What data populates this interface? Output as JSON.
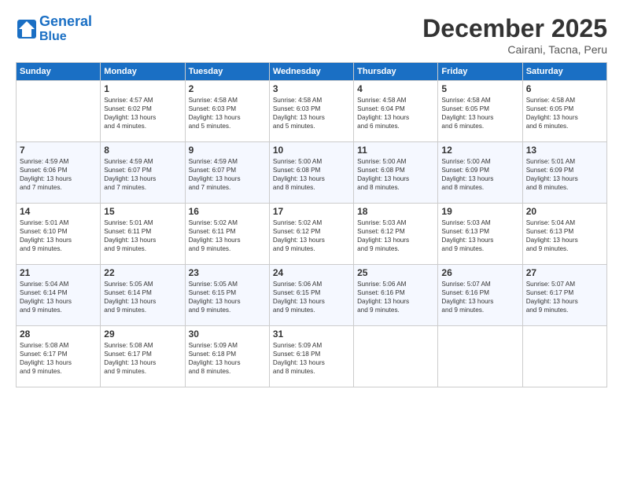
{
  "header": {
    "logo_line1": "General",
    "logo_line2": "Blue",
    "month": "December 2025",
    "location": "Cairani, Tacna, Peru"
  },
  "weekdays": [
    "Sunday",
    "Monday",
    "Tuesday",
    "Wednesday",
    "Thursday",
    "Friday",
    "Saturday"
  ],
  "weeks": [
    [
      {
        "day": "",
        "info": ""
      },
      {
        "day": "1",
        "info": "Sunrise: 4:57 AM\nSunset: 6:02 PM\nDaylight: 13 hours\nand 4 minutes."
      },
      {
        "day": "2",
        "info": "Sunrise: 4:58 AM\nSunset: 6:03 PM\nDaylight: 13 hours\nand 5 minutes."
      },
      {
        "day": "3",
        "info": "Sunrise: 4:58 AM\nSunset: 6:03 PM\nDaylight: 13 hours\nand 5 minutes."
      },
      {
        "day": "4",
        "info": "Sunrise: 4:58 AM\nSunset: 6:04 PM\nDaylight: 13 hours\nand 6 minutes."
      },
      {
        "day": "5",
        "info": "Sunrise: 4:58 AM\nSunset: 6:05 PM\nDaylight: 13 hours\nand 6 minutes."
      },
      {
        "day": "6",
        "info": "Sunrise: 4:58 AM\nSunset: 6:05 PM\nDaylight: 13 hours\nand 6 minutes."
      }
    ],
    [
      {
        "day": "7",
        "info": "Sunrise: 4:59 AM\nSunset: 6:06 PM\nDaylight: 13 hours\nand 7 minutes."
      },
      {
        "day": "8",
        "info": "Sunrise: 4:59 AM\nSunset: 6:07 PM\nDaylight: 13 hours\nand 7 minutes."
      },
      {
        "day": "9",
        "info": "Sunrise: 4:59 AM\nSunset: 6:07 PM\nDaylight: 13 hours\nand 7 minutes."
      },
      {
        "day": "10",
        "info": "Sunrise: 5:00 AM\nSunset: 6:08 PM\nDaylight: 13 hours\nand 8 minutes."
      },
      {
        "day": "11",
        "info": "Sunrise: 5:00 AM\nSunset: 6:08 PM\nDaylight: 13 hours\nand 8 minutes."
      },
      {
        "day": "12",
        "info": "Sunrise: 5:00 AM\nSunset: 6:09 PM\nDaylight: 13 hours\nand 8 minutes."
      },
      {
        "day": "13",
        "info": "Sunrise: 5:01 AM\nSunset: 6:09 PM\nDaylight: 13 hours\nand 8 minutes."
      }
    ],
    [
      {
        "day": "14",
        "info": "Sunrise: 5:01 AM\nSunset: 6:10 PM\nDaylight: 13 hours\nand 9 minutes."
      },
      {
        "day": "15",
        "info": "Sunrise: 5:01 AM\nSunset: 6:11 PM\nDaylight: 13 hours\nand 9 minutes."
      },
      {
        "day": "16",
        "info": "Sunrise: 5:02 AM\nSunset: 6:11 PM\nDaylight: 13 hours\nand 9 minutes."
      },
      {
        "day": "17",
        "info": "Sunrise: 5:02 AM\nSunset: 6:12 PM\nDaylight: 13 hours\nand 9 minutes."
      },
      {
        "day": "18",
        "info": "Sunrise: 5:03 AM\nSunset: 6:12 PM\nDaylight: 13 hours\nand 9 minutes."
      },
      {
        "day": "19",
        "info": "Sunrise: 5:03 AM\nSunset: 6:13 PM\nDaylight: 13 hours\nand 9 minutes."
      },
      {
        "day": "20",
        "info": "Sunrise: 5:04 AM\nSunset: 6:13 PM\nDaylight: 13 hours\nand 9 minutes."
      }
    ],
    [
      {
        "day": "21",
        "info": "Sunrise: 5:04 AM\nSunset: 6:14 PM\nDaylight: 13 hours\nand 9 minutes."
      },
      {
        "day": "22",
        "info": "Sunrise: 5:05 AM\nSunset: 6:14 PM\nDaylight: 13 hours\nand 9 minutes."
      },
      {
        "day": "23",
        "info": "Sunrise: 5:05 AM\nSunset: 6:15 PM\nDaylight: 13 hours\nand 9 minutes."
      },
      {
        "day": "24",
        "info": "Sunrise: 5:06 AM\nSunset: 6:15 PM\nDaylight: 13 hours\nand 9 minutes."
      },
      {
        "day": "25",
        "info": "Sunrise: 5:06 AM\nSunset: 6:16 PM\nDaylight: 13 hours\nand 9 minutes."
      },
      {
        "day": "26",
        "info": "Sunrise: 5:07 AM\nSunset: 6:16 PM\nDaylight: 13 hours\nand 9 minutes."
      },
      {
        "day": "27",
        "info": "Sunrise: 5:07 AM\nSunset: 6:17 PM\nDaylight: 13 hours\nand 9 minutes."
      }
    ],
    [
      {
        "day": "28",
        "info": "Sunrise: 5:08 AM\nSunset: 6:17 PM\nDaylight: 13 hours\nand 9 minutes."
      },
      {
        "day": "29",
        "info": "Sunrise: 5:08 AM\nSunset: 6:17 PM\nDaylight: 13 hours\nand 9 minutes."
      },
      {
        "day": "30",
        "info": "Sunrise: 5:09 AM\nSunset: 6:18 PM\nDaylight: 13 hours\nand 8 minutes."
      },
      {
        "day": "31",
        "info": "Sunrise: 5:09 AM\nSunset: 6:18 PM\nDaylight: 13 hours\nand 8 minutes."
      },
      {
        "day": "",
        "info": ""
      },
      {
        "day": "",
        "info": ""
      },
      {
        "day": "",
        "info": ""
      }
    ]
  ]
}
